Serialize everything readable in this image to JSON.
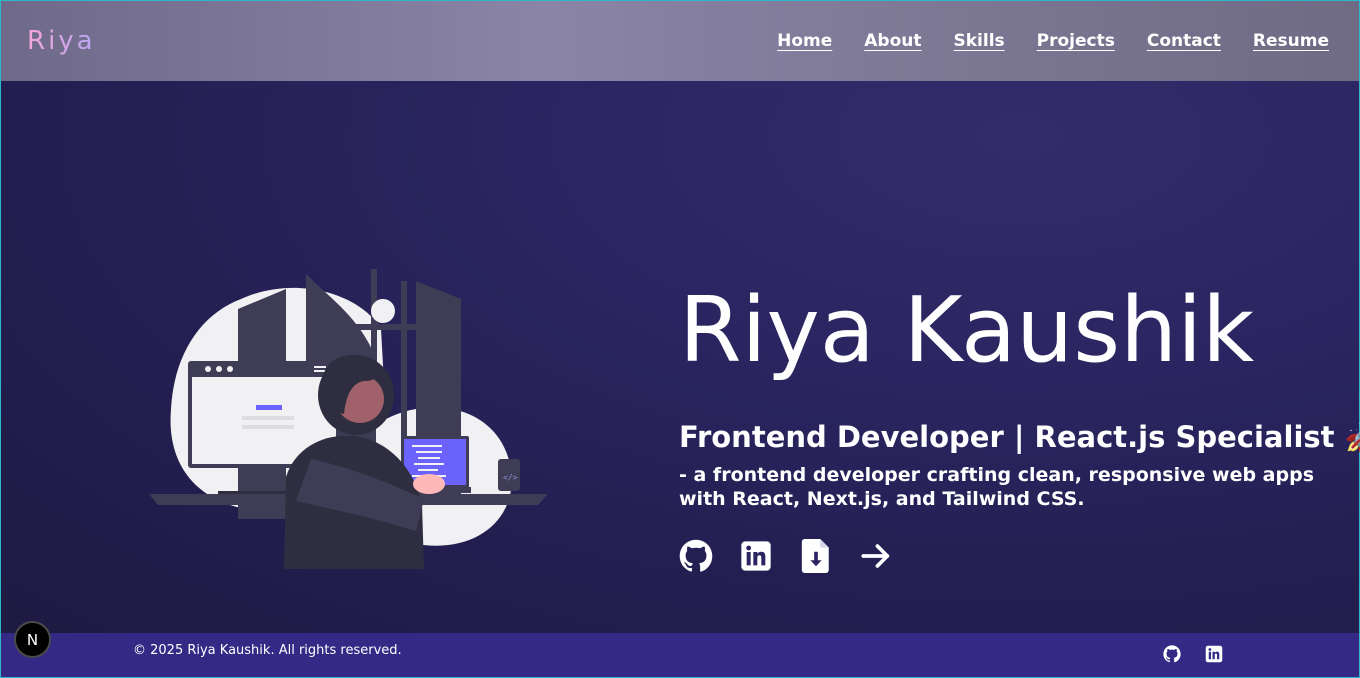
{
  "header": {
    "brand": "Riya",
    "nav": [
      "Home",
      "About",
      "Skills",
      "Projects",
      "Contact",
      "Resume"
    ]
  },
  "hero": {
    "name": "Riya Kaushik",
    "role": "Frontend Developer | React.js Specialist",
    "role_emoji": "🚀",
    "description": "- a frontend developer crafting clean, responsive web apps with React, Next.js, and Tailwind CSS.",
    "socials": [
      "github-icon",
      "linkedin-icon",
      "file-download-icon",
      "arrow-right-icon"
    ]
  },
  "footer": {
    "copyright": "© 2025 Riya Kaushik. All rights reserved.",
    "icons": [
      "github-icon",
      "linkedin-icon"
    ]
  },
  "dev_badge": {
    "label": "N"
  },
  "colors": {
    "hero_bg": "#2a2560",
    "footer_bg": "#342a86",
    "accent": "#6c63ff"
  }
}
